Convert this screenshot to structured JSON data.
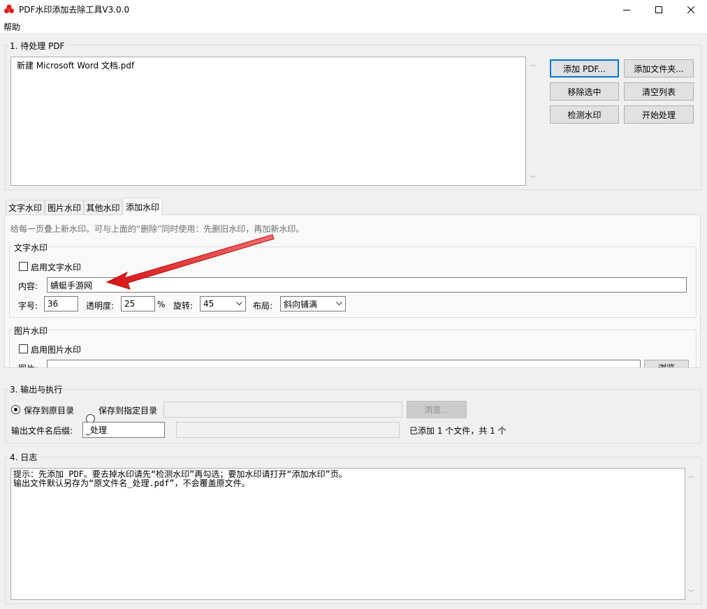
{
  "window": {
    "title": "PDF水印添加去除工具V3.0.0",
    "minimize_glyph": "—",
    "maximize_glyph": "☐",
    "close_glyph": "✕"
  },
  "menu": {
    "help": "帮助"
  },
  "pending": {
    "legend": "1. 待处理 PDF",
    "files": [
      "新建 Microsoft Word 文档.pdf"
    ],
    "buttons": {
      "add_pdf": "添加 PDF...",
      "add_folder": "添加文件夹...",
      "remove_selected": "移除选中",
      "clear_list": "清空列表",
      "detect_watermark": "检测水印",
      "start_process": "开始处理"
    }
  },
  "tabs": {
    "items": [
      "文字水印",
      "图片水印",
      "其他水印",
      "添加水印"
    ],
    "active_index": 3
  },
  "add_watermark": {
    "hint": "给每一页叠上新水印。可与上面的“删除”同时使用：先删旧水印，再加新水印。",
    "text_group": {
      "legend": "文字水印",
      "enable_label": "启用文字水印",
      "enabled": false,
      "content_label": "内容:",
      "content_value": "蜻蜓手游网",
      "size_label": "字号:",
      "size_value": "36",
      "opacity_label": "透明度:",
      "opacity_value": "25",
      "percent": "%",
      "rotate_label": "旋转:",
      "rotate_value": "45",
      "layout_label": "布局:",
      "layout_value": "斜向铺满"
    },
    "image_group": {
      "legend": "图片水印",
      "enable_label": "启用图片水印",
      "enabled": false,
      "image_label": "图片:",
      "browse_label": "浏览"
    }
  },
  "output": {
    "legend": "3. 输出与执行",
    "save_original_label": "保存到原目录",
    "save_custom_label": "保存到指定目录",
    "selected": "original",
    "browse_label": "浏览...",
    "suffix_label": "输出文件名后缀:",
    "suffix_value": "_处理",
    "status": "已添加 1 个文件，共 1 个"
  },
  "log": {
    "legend": "4. 日志",
    "lines": [
      "提示：先添加 PDF。要去掉水印请先“检测水印”再勾选；要加水印请打开“添加水印”页。",
      "输出文件默认另存为“原文件名_处理.pdf”，不会覆盖原文件。"
    ]
  },
  "colors": {
    "accent": "#0078d7",
    "annotation_arrow": "#e31b1b",
    "app_icon": "#e02020"
  },
  "annotation": {
    "type": "arrow",
    "points_to": "content-input"
  }
}
